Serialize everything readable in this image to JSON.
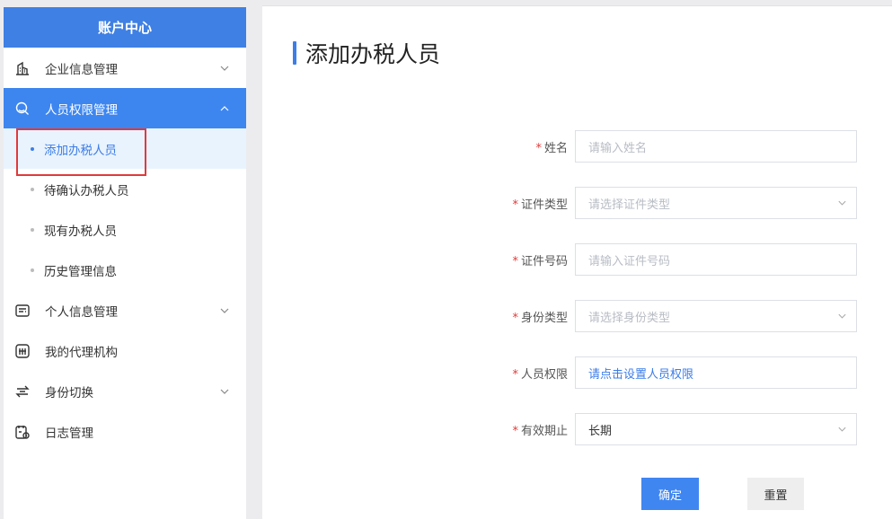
{
  "sidebar": {
    "title": "账户中心",
    "items": [
      {
        "label": "企业信息管理",
        "icon": "building-icon",
        "expandable": true
      },
      {
        "label": "人员权限管理",
        "icon": "user-group-icon",
        "expandable": true,
        "active": true
      },
      {
        "label": "个人信息管理",
        "icon": "id-card-icon",
        "expandable": true
      },
      {
        "label": "我的代理机构",
        "icon": "agency-icon",
        "expandable": false
      },
      {
        "label": "身份切换",
        "icon": "switch-icon",
        "expandable": true
      },
      {
        "label": "日志管理",
        "icon": "log-icon",
        "expandable": false
      }
    ],
    "sub_items": [
      {
        "label": "添加办税人员",
        "selected": true
      },
      {
        "label": "待确认办税人员"
      },
      {
        "label": "现有办税人员"
      },
      {
        "label": "历史管理信息"
      }
    ]
  },
  "page": {
    "title": "添加办税人员"
  },
  "form": {
    "name": {
      "label": "姓名",
      "placeholder": "请输入姓名"
    },
    "id_type": {
      "label": "证件类型",
      "placeholder": "请选择证件类型"
    },
    "id_number": {
      "label": "证件号码",
      "placeholder": "请输入证件号码"
    },
    "identity_type": {
      "label": "身份类型",
      "placeholder": "请选择身份类型"
    },
    "permission": {
      "label": "人员权限",
      "link_text": "请点击设置人员权限"
    },
    "validity": {
      "label": "有效期止",
      "value": "长期"
    },
    "required_mark": "*"
  },
  "buttons": {
    "confirm": "确定",
    "reset": "重置"
  },
  "colors": {
    "primary": "#3f86f1",
    "sidebar_header": "#3f80e4",
    "required": "#e03a3a",
    "selected_bg": "#e9f3fd"
  }
}
